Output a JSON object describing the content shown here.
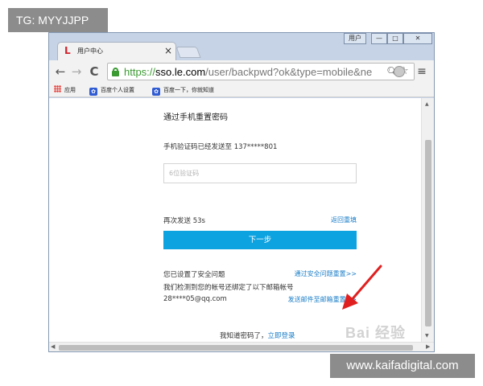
{
  "overlay": {
    "tag": "TG: MYYJJPP",
    "site": "www.kaifadigital.com"
  },
  "browser": {
    "tab_title": "用户中心",
    "tab_close": "×",
    "window_controls": {
      "user": "用户",
      "minimize": "—",
      "maximize": "□",
      "close": "✕"
    },
    "url": {
      "scheme": "https://",
      "host": "sso.le.com",
      "path": "/user/backpwd?ok&type=mobile&ne"
    },
    "bookmarks": [
      {
        "label": "应用",
        "icon": "apps-icon"
      },
      {
        "label": "百度个人设置",
        "icon": "baidu-paw-icon"
      },
      {
        "label": "百度一下，你就知道",
        "icon": "baidu-paw-icon"
      }
    ]
  },
  "form": {
    "title": "通过手机重置密码",
    "sent_message": "手机验证码已经发送至 137*****801",
    "code_placeholder": "6位验证码",
    "code_value": "",
    "resend_countdown": "再次发送 53s",
    "back_reset_link": "返回重填",
    "next_button": "下一步",
    "security_set_text": "您已设置了安全问题",
    "security_reset_link": "通过安全问题重置>>",
    "email_detected_text": "我们检测到您的帐号还绑定了以下邮箱帐号",
    "email_masked": "28****05@qq.com",
    "email_reset_link": "发送邮件至邮箱重置>>",
    "know_password_text": "我知道密码了，",
    "login_link": "立即登录"
  },
  "watermark": "Bai 经验",
  "colors": {
    "accent": "#0da2e0",
    "link": "#1a7ec8",
    "secure_green": "#3b9a32",
    "arrow_red": "#e02020"
  }
}
